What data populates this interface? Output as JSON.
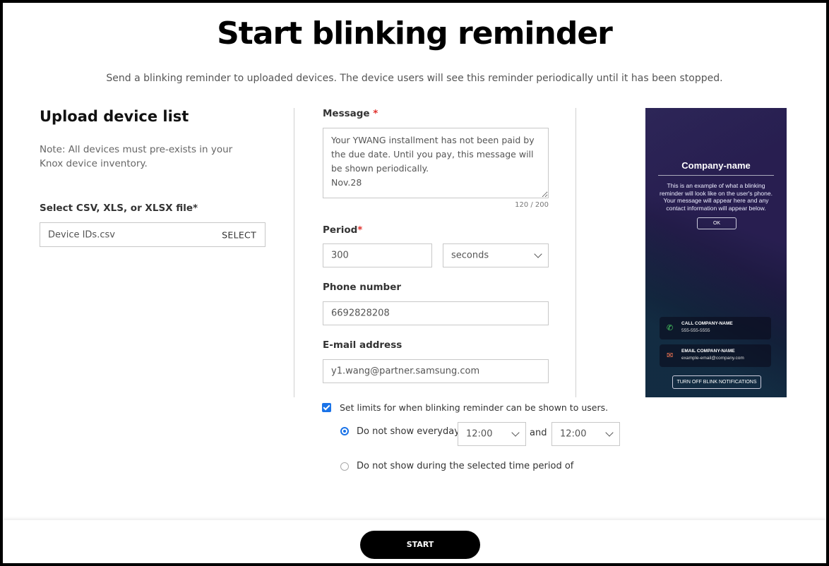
{
  "page": {
    "title": "Start blinking reminder",
    "subtitle": "Send a blinking reminder to uploaded devices. The device users will see this reminder periodically until it has been stopped."
  },
  "upload": {
    "heading": "Upload device list",
    "note": "Note: All devices must pre-exists in your Knox device inventory.",
    "file_label": "Select CSV, XLS, or XLSX file*",
    "file_value": "Device IDs.csv",
    "select_label": "SELECT"
  },
  "form": {
    "message_label": "Message",
    "message_required": "*",
    "message_value": "Your YWANG installment has not been paid by the due date. Until you pay, this message will be shown periodically.\nNov.28",
    "message_counter": "120 / 200",
    "period_label": "Period",
    "period_required": "*",
    "period_value": "300",
    "period_unit": "seconds",
    "phone_label": "Phone number",
    "phone_value": "6692828208",
    "email_label": "E-mail address",
    "email_value": "y1.wang@partner.samsung.com"
  },
  "preview": {
    "company": "Company-name",
    "body": "This is an example of what a blinking reminder will look like on the user's phone. Your message will appear here and any contact information will appear below.",
    "ok": "OK",
    "call_title": "CALL COMPANY-NAME",
    "call_value": "555-555-5555",
    "email_title": "EMAIL COMPANY-NAME",
    "email_value": "example-email@company.com",
    "turn_off": "TURN OFF BLINK NOTIFICATIONS"
  },
  "limits": {
    "checkbox_label": "Set limits for when blinking reminder can be shown to users.",
    "checked": true,
    "option1_label": "Do not show everyday",
    "start_time": "12:00",
    "and_label": "and",
    "end_time": "12:00",
    "option2_label": "Do not show during the selected time period of",
    "selected_option": 1
  },
  "footer": {
    "start_label": "START"
  },
  "colors": {
    "accent": "#1a73e8",
    "required": "#e0302c",
    "button": "#000000"
  }
}
